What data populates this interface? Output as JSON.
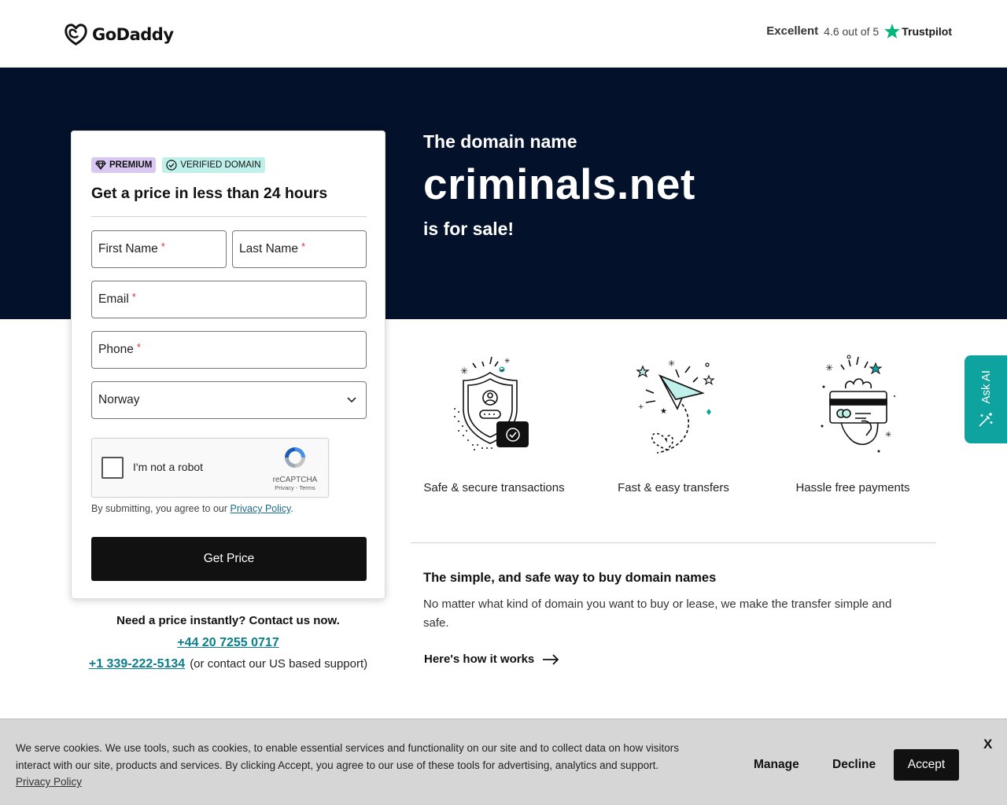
{
  "header": {
    "logo_text": "GoDaddy",
    "trust_label": "Excellent",
    "trust_rating": "4.6 out of 5",
    "trust_brand": "Trustpilot"
  },
  "hero": {
    "pre": "The domain name",
    "domain": "criminals.net",
    "post": "is for sale!"
  },
  "form": {
    "badge_premium": "PREMIUM",
    "badge_verified": "VERIFIED DOMAIN",
    "title": "Get a price in less than 24 hours",
    "first_name": "First Name",
    "last_name": "Last Name",
    "email": "Email",
    "phone": "Phone",
    "required_mark": "*",
    "country": "Norway",
    "captcha_label": "I'm not a robot",
    "captcha_brand": "reCAPTCHA",
    "captcha_links": "Privacy - Terms",
    "consent_prefix": "By submitting, you agree to our",
    "consent_link": "Privacy Policy",
    "consent_suffix": ".",
    "submit": "Get Price"
  },
  "contact": {
    "heading": "Need a price instantly? Contact us now.",
    "phone_uk": "+44 20 7255 0717",
    "phone_us": "+1 339-222-5134",
    "us_note": "(or contact our US based support)"
  },
  "features": [
    {
      "label": "Safe & secure transactions",
      "icon": "shield-icon"
    },
    {
      "label": "Fast & easy transfers",
      "icon": "paper-plane-icon"
    },
    {
      "label": "Hassle free payments",
      "icon": "card-hand-icon"
    }
  ],
  "section": {
    "title": "The simple, and safe way to buy domain names",
    "body": "No matter what kind of domain you want to buy or lease, we make the transfer simple and safe.",
    "link": "Here's how it works"
  },
  "ask_ai": {
    "label": "Ask AI"
  },
  "cookie": {
    "text": "We serve cookies. We use tools, such as cookies, to enable essential services and functionality on our site and to collect data on how visitors interact with our site, products and services. By clicking Accept, you agree to our use of these tools for advertising, analytics and support.",
    "policy_link": "Privacy Policy",
    "manage": "Manage",
    "decline": "Decline",
    "accept": "Accept",
    "close": "X"
  },
  "colors": {
    "hero_bg": "#03112a",
    "accent_teal": "#0fa3a0",
    "link_teal": "#0a7e8c",
    "premium_badge": "#d9c9f2",
    "verified_badge": "#bff0ea"
  }
}
